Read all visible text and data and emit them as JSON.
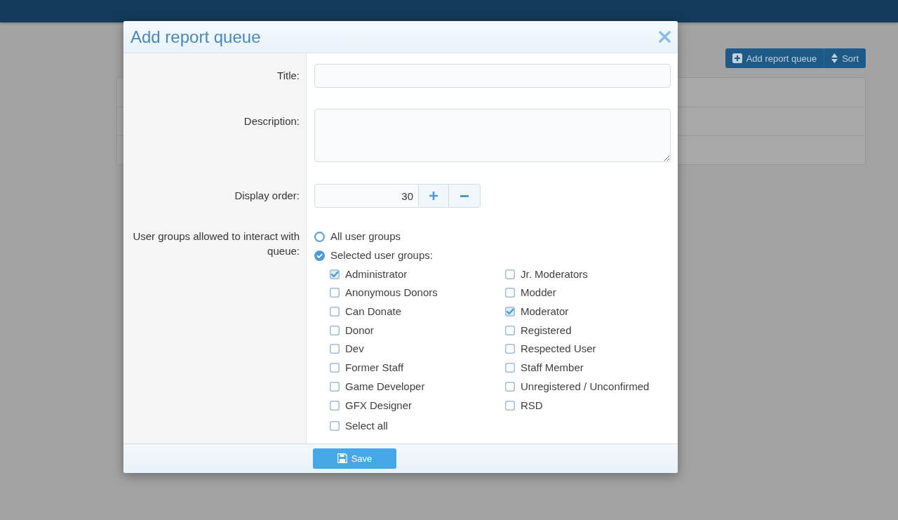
{
  "page": {
    "toolbar_buttons": [
      {
        "kind": "add",
        "label": "Add report queue"
      },
      {
        "kind": "sort",
        "label": "Sort"
      }
    ]
  },
  "dialog": {
    "title": "Add report queue",
    "fields": [
      {
        "kind": "text",
        "label": "Title:"
      },
      {
        "kind": "textarea",
        "label": "Description:"
      },
      {
        "kind": "number",
        "label": "Display order:",
        "value": "30"
      }
    ],
    "user_groups": {
      "label": "User groups allowed to interact with queue:",
      "options": [
        {
          "label": "All user groups",
          "selected": false
        },
        {
          "label": "Selected user groups:",
          "selected": true
        }
      ],
      "groups": [
        {
          "label": "Administrator",
          "checked": true
        },
        {
          "label": "Anonymous Donors",
          "checked": false
        },
        {
          "label": "Can Donate",
          "checked": false
        },
        {
          "label": "Donor",
          "checked": false
        },
        {
          "label": "Dev",
          "checked": false
        },
        {
          "label": "Former Staff",
          "checked": false
        },
        {
          "label": "Game Developer",
          "checked": false
        },
        {
          "label": "GFX Designer",
          "checked": false
        },
        {
          "label": "Jr. Moderators",
          "checked": false
        },
        {
          "label": "Modder",
          "checked": false
        },
        {
          "label": "Moderator",
          "checked": true
        },
        {
          "label": "Registered",
          "checked": false
        },
        {
          "label": "Respected User",
          "checked": false
        },
        {
          "label": "Staff Member",
          "checked": false
        },
        {
          "label": "Unregistered / Unconfirmed",
          "checked": false
        },
        {
          "label": "RSD",
          "checked": false
        }
      ],
      "select_all": {
        "label": "Select all",
        "checked": false
      }
    },
    "save_button": {
      "label": "Save"
    }
  }
}
